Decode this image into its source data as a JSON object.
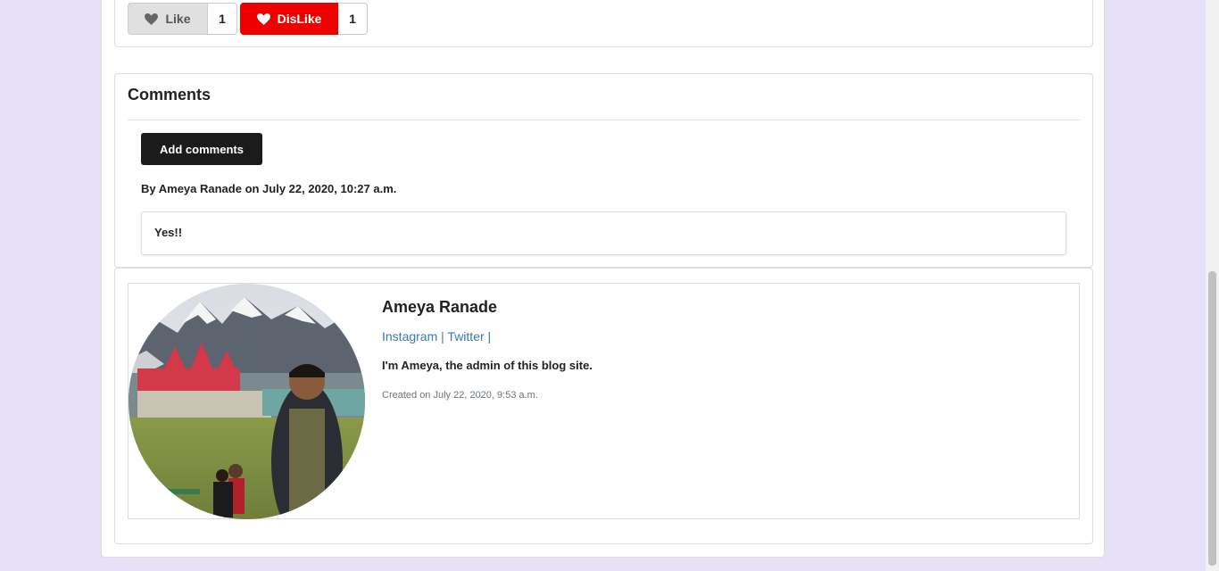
{
  "reactions": {
    "like_label": "Like",
    "like_count": "1",
    "dislike_label": "DisLike",
    "dislike_count": "1"
  },
  "comments": {
    "title": "Comments",
    "add_button": "Add comments",
    "items": [
      {
        "meta": "By Ameya Ranade on July 22, 2020, 10:27 a.m.",
        "text": "Yes!!"
      }
    ]
  },
  "author": {
    "name": "Ameya Ranade",
    "links": [
      "Instagram",
      "Twitter"
    ],
    "separator": "|",
    "bio": "I'm Ameya, the admin of this blog site.",
    "created": "Created on July 22, 2020, 9:53 a.m."
  },
  "colors": {
    "dislike_red": "#ee0000",
    "link_blue": "#337ab7",
    "background": "#e6e0f8"
  }
}
